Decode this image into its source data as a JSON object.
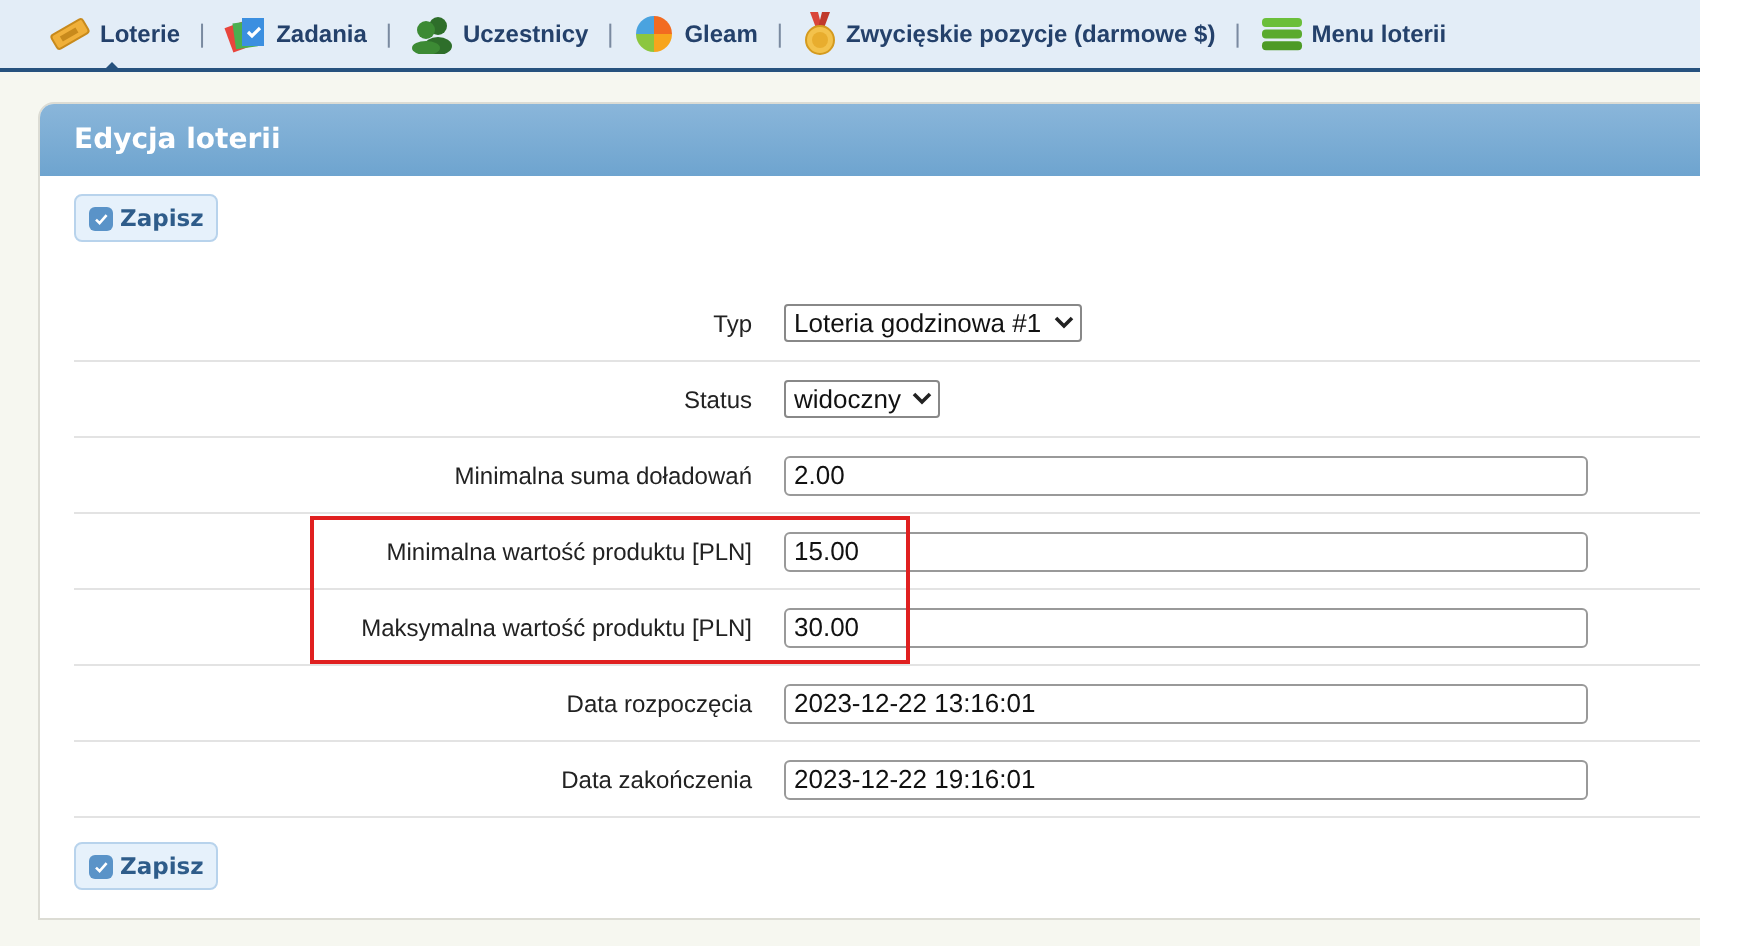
{
  "nav": [
    {
      "label": "Loterie",
      "selected": true
    },
    {
      "label": "Zadania",
      "selected": false
    },
    {
      "label": "Uczestnicy",
      "selected": false
    },
    {
      "label": "Gleam",
      "selected": false
    },
    {
      "label": "Zwycięskie pozycje (darmowe $)",
      "selected": false
    },
    {
      "label": "Menu loterii",
      "selected": false
    }
  ],
  "nav_separator": "|",
  "panel": {
    "title": "Edycja loterii"
  },
  "save_button": "Zapisz",
  "fields": [
    {
      "label": "Typ",
      "kind": "select",
      "value": "Loteria godzinowa #1",
      "highlighted": false
    },
    {
      "label": "Status",
      "kind": "select",
      "value": "widoczny",
      "highlighted": false
    },
    {
      "label": "Minimalna suma doładowań",
      "kind": "text",
      "value": "2.00",
      "highlighted": false
    },
    {
      "label": "Minimalna wartość produktu [PLN]",
      "kind": "text",
      "value": "15.00",
      "highlighted": true
    },
    {
      "label": "Maksymalna wartość produktu [PLN]",
      "kind": "text",
      "value": "30.00",
      "highlighted": true
    },
    {
      "label": "Data rozpoczęcia",
      "kind": "text",
      "value": "2023-12-22 13:16:01",
      "highlighted": false
    },
    {
      "label": "Data zakończenia",
      "kind": "text",
      "value": "2023-12-22 19:16:01",
      "highlighted": false
    }
  ],
  "bottom_save_button": "Zapisz"
}
